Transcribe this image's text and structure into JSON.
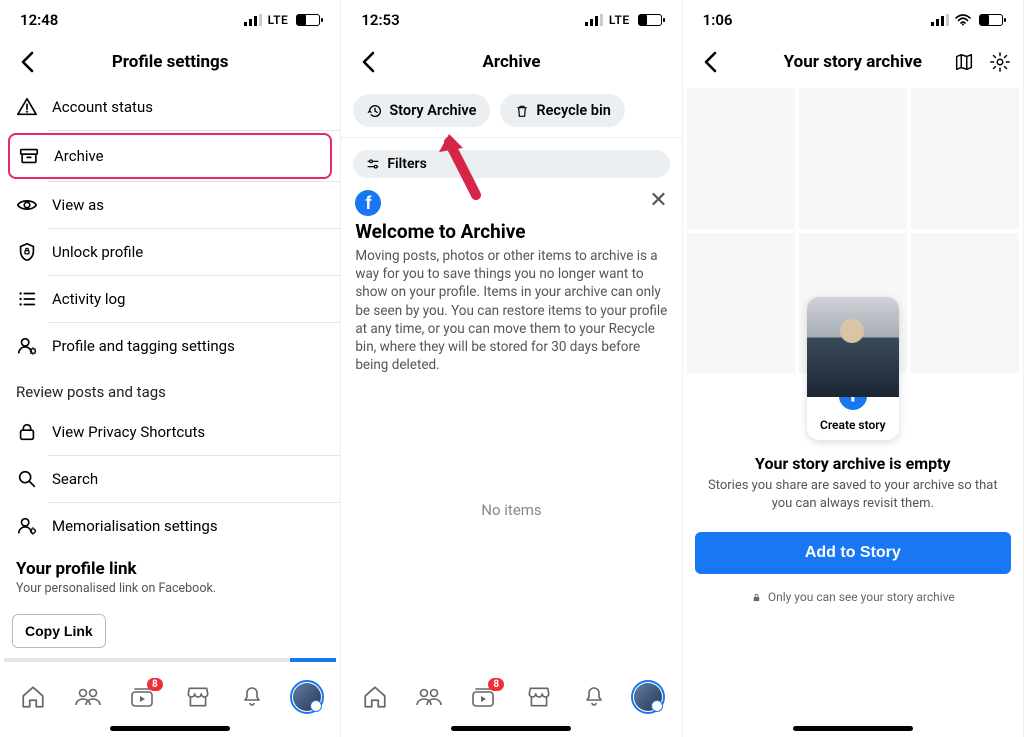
{
  "screen1": {
    "status": {
      "time": "12:48",
      "network": "LTE"
    },
    "title": "Profile settings",
    "items": [
      {
        "label": "Account status"
      },
      {
        "label": "Archive"
      },
      {
        "label": "View as"
      },
      {
        "label": "Unlock profile"
      },
      {
        "label": "Activity log"
      },
      {
        "label": "Profile and tagging settings"
      }
    ],
    "review_caption": "Review posts and tags",
    "items2": [
      {
        "label": "View Privacy Shortcuts"
      },
      {
        "label": "Search"
      },
      {
        "label": "Memorialisation settings"
      }
    ],
    "profile_link": {
      "title": "Your profile link",
      "subtitle": "Your personalised link on Facebook.",
      "button": "Copy Link"
    },
    "tabs": {
      "badge": "8"
    }
  },
  "screen2": {
    "status": {
      "time": "12:53",
      "network": "LTE"
    },
    "title": "Archive",
    "chips": {
      "story": "Story Archive",
      "recycle": "Recycle bin"
    },
    "filters": "Filters",
    "welcome": {
      "title": "Welcome to Archive",
      "body": "Moving posts, photos or other items to archive is a way for you to save things you no longer want to show on your profile. Items in your archive can only be seen by you. You can restore items to your profile at any time, or you can move them to your Recycle bin, where they will be stored for 30 days before being deleted."
    },
    "no_items": "No items",
    "tabs": {
      "badge": "8"
    }
  },
  "screen3": {
    "status": {
      "time": "1:06"
    },
    "title": "Your story archive",
    "create_label": "Create story",
    "empty": {
      "title": "Your story archive is empty",
      "body": "Stories you share are saved to your archive so that you can always revisit them."
    },
    "cta": "Add to Story",
    "privacy": "Only you can see your story archive"
  }
}
